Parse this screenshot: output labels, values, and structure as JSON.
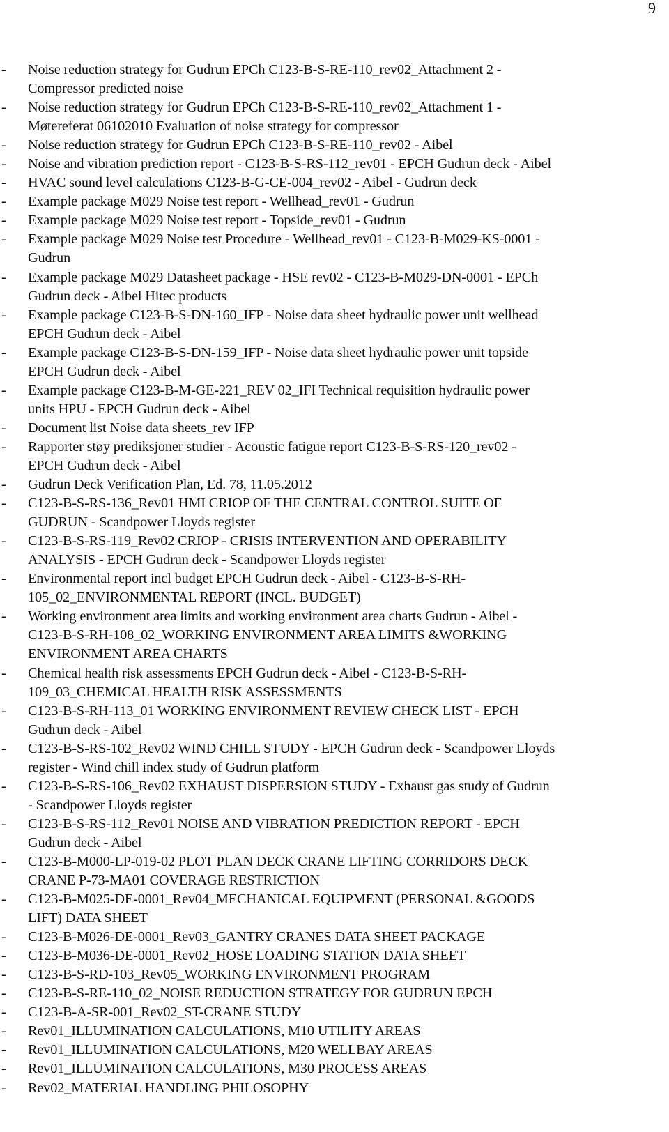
{
  "page": {
    "number": "9"
  },
  "list": {
    "bullet": "-",
    "items": [
      {
        "lines": [
          "Noise reduction strategy for Gudrun EPCh C123-B-S-RE-110_rev02_Attachment 2 -",
          "Compressor predicted noise"
        ]
      },
      {
        "lines": [
          "Noise reduction strategy for Gudrun EPCh C123-B-S-RE-110_rev02_Attachment 1 -",
          "Møtereferat 06102010 Evaluation of noise strategy for compressor"
        ]
      },
      {
        "lines": [
          "Noise reduction strategy for Gudrun EPCh C123-B-S-RE-110_rev02 - Aibel"
        ]
      },
      {
        "lines": [
          "Noise and vibration prediction report - C123-B-S-RS-112_rev01 - EPCH Gudrun deck - Aibel"
        ]
      },
      {
        "lines": [
          "HVAC sound level calculations C123-B-G-CE-004_rev02 - Aibel - Gudrun deck"
        ]
      },
      {
        "lines": [
          "Example package M029 Noise test report - Wellhead_rev01 - Gudrun"
        ]
      },
      {
        "lines": [
          "Example package M029 Noise test report - Topside_rev01 - Gudrun"
        ]
      },
      {
        "lines": [
          "Example package M029 Noise test Procedure - Wellhead_rev01 - C123-B-M029-KS-0001 -",
          "Gudrun"
        ]
      },
      {
        "lines": [
          "Example package M029 Datasheet package - HSE rev02 - C123-B-M029-DN-0001 - EPCh",
          "Gudrun deck - Aibel Hitec products"
        ]
      },
      {
        "lines": [
          "Example package C123-B-S-DN-160_IFP - Noise data sheet hydraulic power unit wellhead",
          "EPCH Gudrun deck - Aibel"
        ]
      },
      {
        "lines": [
          "Example package C123-B-S-DN-159_IFP - Noise data sheet hydraulic power unit topside",
          "EPCH Gudrun deck - Aibel"
        ]
      },
      {
        "lines": [
          "Example package C123-B-M-GE-221_REV 02_IFI Technical requisition hydraulic power",
          "units HPU - EPCH Gudrun deck - Aibel"
        ]
      },
      {
        "lines": [
          "Document list Noise data sheets_rev IFP"
        ]
      },
      {
        "lines": [
          "Rapporter støy prediksjoner studier - Acoustic fatigue report C123-B-S-RS-120_rev02 -",
          "EPCH Gudrun deck - Aibel"
        ]
      },
      {
        "lines": [
          "Gudrun Deck Verification Plan, Ed. 78, 11.05.2012"
        ]
      },
      {
        "lines": [
          "C123-B-S-RS-136_Rev01 HMI CRIOP OF THE CENTRAL CONTROL SUITE OF",
          "GUDRUN - Scandpower Lloyds register"
        ]
      },
      {
        "lines": [
          "C123-B-S-RS-119_Rev02 CRIOP - CRISIS INTERVENTION AND OPERABILITY",
          "ANALYSIS - EPCH Gudrun deck - Scandpower Lloyds register"
        ]
      },
      {
        "lines": [
          "Environmental report incl budget EPCH Gudrun deck - Aibel - C123-B-S-RH-",
          "105_02_ENVIRONMENTAL REPORT (INCL. BUDGET)"
        ]
      },
      {
        "lines": [
          "Working environment area limits and working environment area charts Gudrun - Aibel -",
          "C123-B-S-RH-108_02_WORKING ENVIRONMENT AREA LIMITS &WORKING",
          "ENVIRONMENT AREA CHARTS"
        ]
      },
      {
        "lines": [
          "Chemical health risk assessments EPCH Gudrun deck - Aibel - C123-B-S-RH-",
          "109_03_CHEMICAL HEALTH RISK ASSESSMENTS"
        ]
      },
      {
        "lines": [
          "C123-B-S-RH-113_01 WORKING ENVIRONMENT REVIEW CHECK LIST - EPCH",
          "Gudrun deck - Aibel"
        ]
      },
      {
        "lines": [
          "C123-B-S-RS-102_Rev02 WIND CHILL STUDY - EPCH Gudrun deck - Scandpower Lloyds",
          "register - Wind chill index study of Gudrun platform"
        ]
      },
      {
        "lines": [
          "C123-B-S-RS-106_Rev02 EXHAUST DISPERSION STUDY - Exhaust gas study of Gudrun",
          "- Scandpower Lloyds register"
        ]
      },
      {
        "lines": [
          "C123-B-S-RS-112_Rev01 NOISE AND VIBRATION PREDICTION REPORT - EPCH",
          "Gudrun deck - Aibel"
        ]
      },
      {
        "lines": [
          "C123-B-M000-LP-019-02 PLOT PLAN DECK CRANE LIFTING CORRIDORS DECK",
          "CRANE P-73-MA01 COVERAGE RESTRICTION"
        ]
      },
      {
        "lines": [
          "C123-B-M025-DE-0001_Rev04_MECHANICAL EQUIPMENT (PERSONAL &GOODS",
          "LIFT) DATA SHEET"
        ]
      },
      {
        "lines": [
          "C123-B-M026-DE-0001_Rev03_GANTRY CRANES DATA SHEET PACKAGE"
        ]
      },
      {
        "lines": [
          "C123-B-M036-DE-0001_Rev02_HOSE LOADING STATION DATA SHEET"
        ]
      },
      {
        "lines": [
          "C123-B-S-RD-103_Rev05_WORKING ENVIRONMENT PROGRAM"
        ]
      },
      {
        "lines": [
          "C123-B-S-RE-110_02_NOISE REDUCTION STRATEGY FOR GUDRUN EPCH"
        ]
      },
      {
        "lines": [
          "C123-B-A-SR-001_Rev02_ST-CRANE STUDY"
        ]
      },
      {
        "lines": [
          "Rev01_ILLUMINATION CALCULATIONS, M10 UTILITY AREAS"
        ]
      },
      {
        "lines": [
          "Rev01_ILLUMINATION CALCULATIONS, M20 WELLBAY AREAS"
        ]
      },
      {
        "lines": [
          "Rev01_ILLUMINATION CALCULATIONS, M30 PROCESS AREAS"
        ]
      },
      {
        "lines": [
          "Rev02_MATERIAL HANDLING PHILOSOPHY"
        ]
      }
    ]
  }
}
